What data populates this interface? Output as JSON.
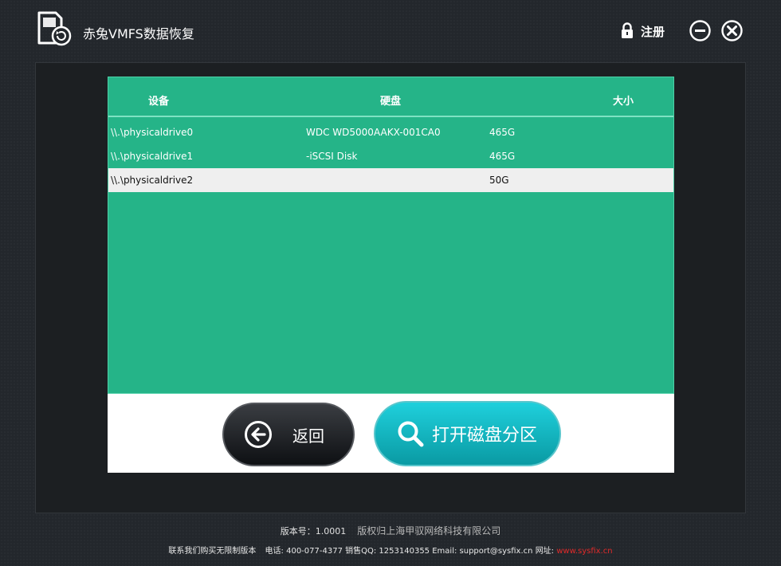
{
  "window": {
    "title": "赤兔VMFS数据恢复",
    "register_label": "注册"
  },
  "table": {
    "headers": {
      "device": "设备",
      "disk": "硬盘",
      "size": "大小"
    },
    "rows": [
      {
        "device": "\\\\.\\physicaldrive0",
        "disk": "WDC WD5000AAKX-001CA0",
        "size": "465G"
      },
      {
        "device": "\\\\.\\physicaldrive1",
        "disk": "-iSCSI Disk",
        "size": "465G"
      },
      {
        "device": "\\\\.\\physicaldrive2",
        "disk": "",
        "size": "50G"
      }
    ],
    "selected_row": 2
  },
  "actions": {
    "back_label": "返回",
    "open_label": "打开磁盘分区"
  },
  "footer": {
    "version": "版本号：1.0001",
    "copyright": "版权归上海甲驭网络科技有限公司",
    "contact_buy": "联系我们购买无限制版本",
    "phone": "电话: 400-077-4377",
    "qq": "销售QQ: 1253140355",
    "email": "Email: support@sysfix.cn",
    "site_label": "网址:",
    "site_url": "www.sysfix.cn"
  },
  "colors": {
    "table_green": "#25b488",
    "selected_row": "#efefef",
    "open_button": "#14b7c2",
    "back_button": "#1e2125",
    "site_link": "#e02a2a"
  },
  "icons": [
    "app-disk-restore-icon",
    "lock-icon",
    "minimize-icon",
    "close-icon",
    "arrow-left-icon",
    "search-icon"
  ]
}
